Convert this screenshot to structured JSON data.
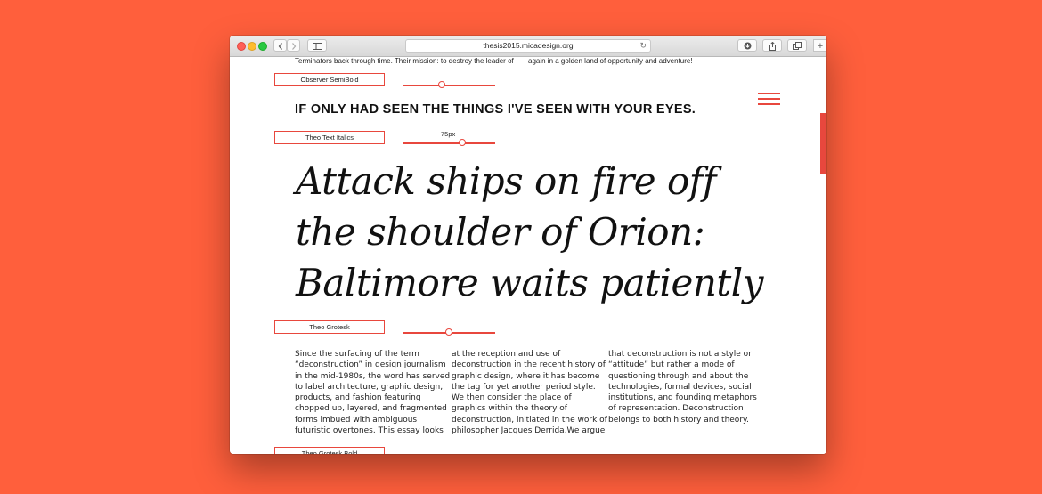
{
  "browser": {
    "url": "thesis2015.micadesign.org",
    "back_icon": "chevron-left-icon",
    "forward_icon": "chevron-right-icon",
    "sidebar_icon": "sidebar-icon",
    "reload_icon": "reload-icon",
    "download_icon": "download-icon",
    "share_icon": "share-icon",
    "tabs_icon": "tabs-icon",
    "new_tab_label": "+"
  },
  "page": {
    "top_text_left": "Terminators back through time. Their mission: to destroy the leader of",
    "top_text_right": "again in a golden land of opportunity and adventure!",
    "specimens": [
      {
        "label": "Observer SemiBold",
        "value": "",
        "level": 0.42
      },
      {
        "label": "Theo Text Italics",
        "value": "75px",
        "level": 0.64
      },
      {
        "label": "Theo Grotesk",
        "value": "",
        "level": 0.5
      },
      {
        "label": "Theo Grotesk Bold"
      }
    ],
    "headline": "IF ONLY HAD SEEN THE THINGS I'VE SEEN WITH YOUR EYES.",
    "display_lines": [
      "Attack ships on fire off",
      "the shoulder of Orion:",
      "Baltimore waits patiently"
    ],
    "body_columns": [
      [
        "Since the surfacing of the term",
        "“deconstruction” in design journalism",
        "in the mid-1980s, the word has served",
        "to label architecture, graphic design,",
        "products, and fashion featuring",
        "chopped up, layered, and fragmented",
        "forms imbued with ambiguous",
        "futuristic overtones. This essay looks"
      ],
      [
        "at the reception and use of",
        "deconstruction in the recent history of",
        "graphic design, where it has become",
        "the tag for yet another period style.",
        "We then consider the place of",
        "graphics within the theory of",
        "deconstruction, initiated in the work of",
        "philosopher Jacques Derrida.We argue"
      ],
      [
        "that deconstruction is not a style or",
        "“attitude” but rather a mode of",
        "questioning through and about the",
        "technologies, formal devices, social",
        "institutions, and founding metaphors",
        "of representation. Deconstruction",
        "belongs to both history and theory."
      ]
    ],
    "menu_icon": "hamburger-menu-icon",
    "accent_color": "#e8473d",
    "background_color": "#ff5f3c"
  }
}
